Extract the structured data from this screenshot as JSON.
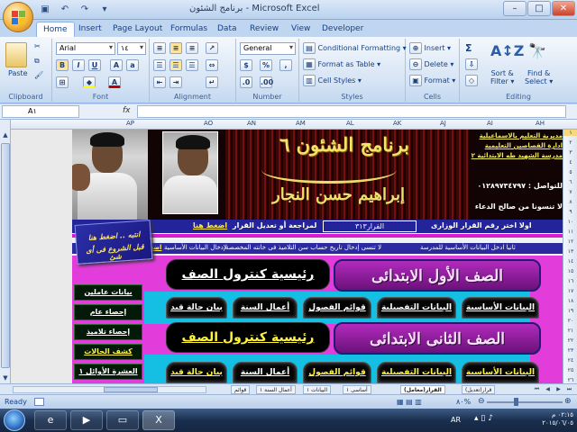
{
  "window": {
    "title": "برنامج الشئون - Microsoft Excel"
  },
  "tabs": [
    "Home",
    "Insert",
    "Page Layout",
    "Formulas",
    "Data",
    "Review",
    "View",
    "Developer"
  ],
  "ribbon": {
    "clipboard": {
      "paste": "Paste",
      "label": "Clipboard"
    },
    "font": {
      "name": "Arial",
      "size": "١٤",
      "bold": "B",
      "italic": "I",
      "underline": "U",
      "label": "Font"
    },
    "alignment": {
      "label": "Alignment"
    },
    "number": {
      "format": "General",
      "percent": "%",
      "label": "Number"
    },
    "styles": {
      "conditional": "Conditional Formatting",
      "table": "Format as Table",
      "cell_styles": "Cell Styles",
      "label": "Styles"
    },
    "cells": {
      "insert": "Insert",
      "delete": "Delete",
      "format": "Format",
      "label": "Cells"
    },
    "editing": {
      "sigma": "Σ",
      "sort": "Sort &",
      "filter": "Filter",
      "find": "Find &",
      "select": "Select",
      "label": "Editing"
    }
  },
  "formula_bar": {
    "namebox": "A١",
    "fx": "fx",
    "content": ""
  },
  "columns": [
    "AH",
    "AI",
    "AJ",
    "AK",
    "AL",
    "AM",
    "AN",
    "AO",
    "AP"
  ],
  "rows": [
    "١",
    "٢",
    "٣",
    "٤",
    "٥",
    "٦",
    "٧",
    "٨",
    "٩",
    "١٠",
    "١١",
    "١٢",
    "١٣",
    "١٤",
    "١٥",
    "١٦",
    "١٧",
    "١٨",
    "١٩",
    "٢٠",
    "٢١",
    "٢٢",
    "٢٣",
    "٢٤",
    "٢٥",
    "٢٦"
  ],
  "banner": {
    "title": "برنامج الشئون ٦",
    "author": "إبراهيم حسن النجار",
    "directorate": [
      "مديرية التعليم بالاسماعيلية",
      "ادارة القصاصين التعليمية",
      "مدرسة الشهيد طه الابتدائية ٢"
    ],
    "phone": "للتواصل : ٠١٢٨٩٧٣٤٧٩٧",
    "dua": "لا تنسونا من صالح الدعاء"
  },
  "decision_bar": {
    "step": "اولا اختر رقم القرار الوزارى",
    "decision": "القرار٣١٣",
    "review": "لمراجعة أو تعديل القرار",
    "link": "اضغط هنا"
  },
  "notice_bar": {
    "text1": "ثانيا ادخل البيانات الأساسية للمدرسة",
    "text2": "لا تنسى إدخال تاريخ حساب سن التلاميذ فى خانته المخصصة",
    "text3": "لإدخال البيانات الأساسية",
    "link": "اضغط هنا"
  },
  "note": {
    "line1": "انتبه .. اضغط هنا",
    "line2": "قبل الشروع فى أى شئ"
  },
  "grade1": {
    "title": "الصف الأول الابتدائى",
    "control": "رئيسية كنترول الصف",
    "buttons": [
      "البيانات الأساسية",
      "البيانات التفصيلية",
      "قوائم الفصول",
      "أعمال السنة",
      "بيان حالة قيد"
    ]
  },
  "grade2": {
    "title": "الصف الثانى الابتدائى",
    "control": "رئيسية كنترول الصف",
    "buttons": [
      "البيانات الأساسية",
      "البيانات التفصيلية",
      "قوائم الفصول",
      "أعمال السنة",
      "بيان حالة قيد"
    ]
  },
  "side_buttons": [
    "بيانات عاملين",
    "إحصاء عام",
    "إحصاء تلاميذ",
    "كشف الحالات",
    "العشرة الأوائل ١"
  ],
  "sheet_tabs": [
    "قوائم",
    "أعمال السنة ١",
    "البيانات ١",
    "أساسى ١",
    "القرار(معامل)",
    "قرار(تعديل)"
  ],
  "status": {
    "ready": "Ready",
    "zoom": "٨٠%"
  },
  "taskbar": {
    "lang": "AR",
    "time": "٠٢:١٥ م",
    "date": "٢٠١٥/٠٦/٠٥"
  },
  "colors": {
    "banner_bg": "#120404",
    "decision_bar": "#23249a",
    "panel": "#e23ddb",
    "cyan": "#14bfe3"
  }
}
